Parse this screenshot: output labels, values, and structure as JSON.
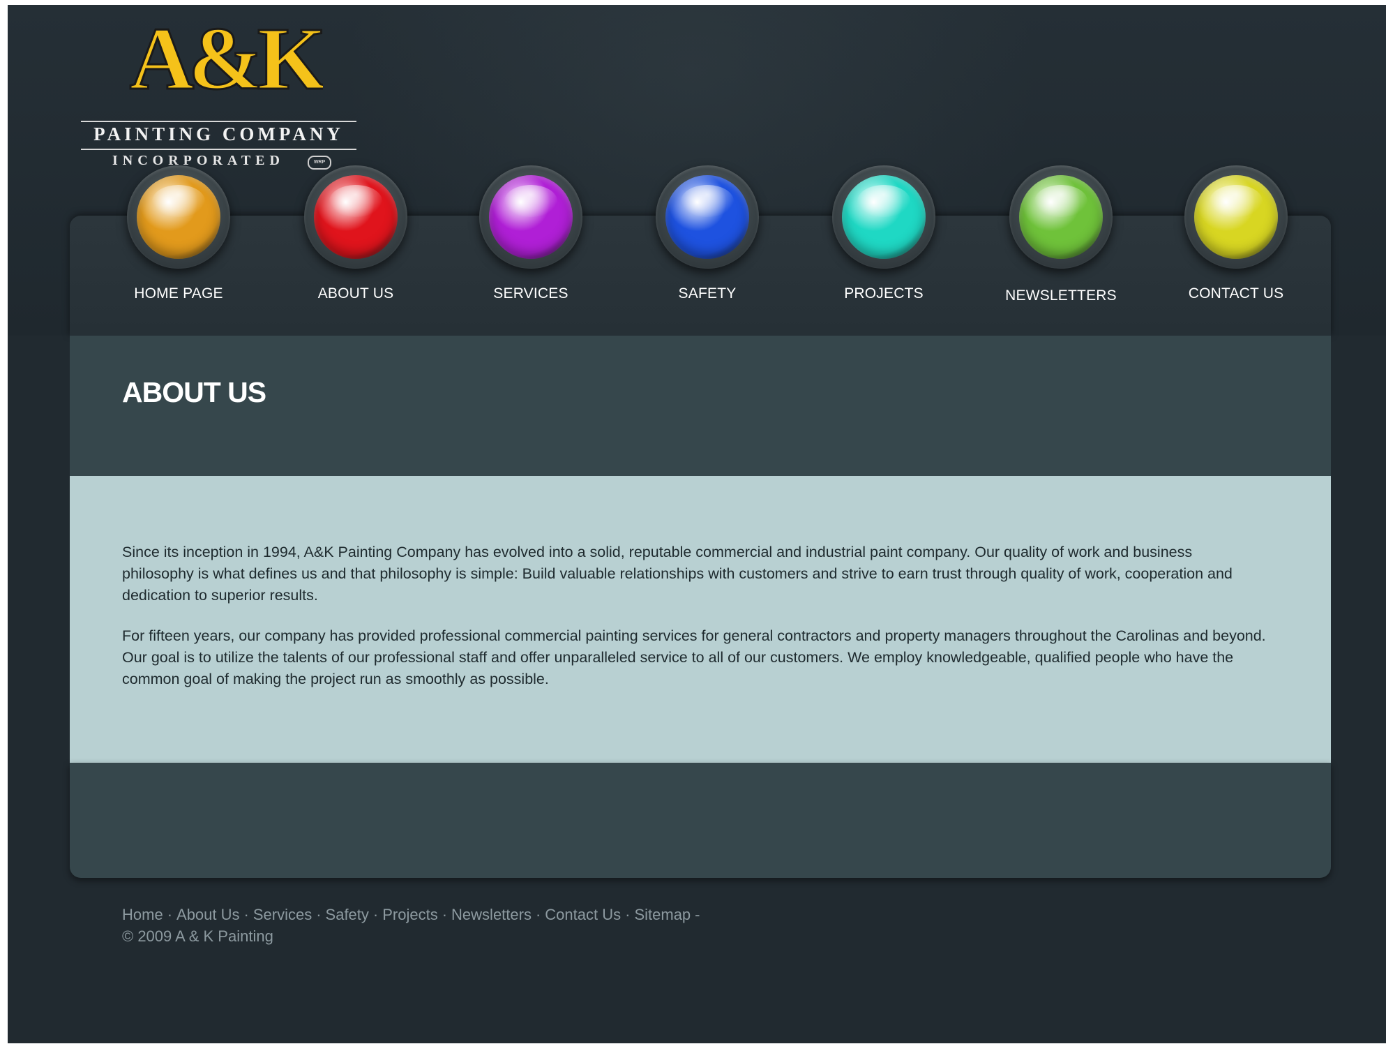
{
  "brand": {
    "logo_mark": "A&K",
    "company": "PAINTING COMPANY",
    "incorporated": "INCORPORATED",
    "badge": "WRP",
    "colors": {
      "logo_yellow": "#f5c21a",
      "logo_outline": "#1a1a1a"
    }
  },
  "nav": {
    "items": [
      {
        "label": "HOME PAGE",
        "orb_color": "#e29a1c",
        "orb_icon": "orange-orb-icon"
      },
      {
        "label": "ABOUT US",
        "orb_color": "#e0141c",
        "orb_icon": "red-orb-icon"
      },
      {
        "label": "SERVICES",
        "orb_color": "#b01fd6",
        "orb_icon": "purple-orb-icon"
      },
      {
        "label": "SAFETY",
        "orb_color": "#1e52e0",
        "orb_icon": "blue-orb-icon"
      },
      {
        "label": "PROJECTS",
        "orb_color": "#1fd8c4",
        "orb_icon": "teal-orb-icon"
      },
      {
        "label": "NEWSLETTERS",
        "orb_color": "#6fc23a",
        "orb_icon": "green-orb-icon"
      },
      {
        "label": "CONTACT US",
        "orb_color": "#d8d622",
        "orb_icon": "yellow-orb-icon"
      }
    ]
  },
  "page": {
    "title": "ABOUT US",
    "paragraphs": [
      "Since its inception in 1994, A&K Painting Company has evolved into a solid, reputable commercial and industrial paint company. Our quality of work and business philosophy is what defines us and that philosophy is simple: Build valuable relationships with customers and strive to earn trust through quality of work, cooperation and dedication to superior results.",
      "For fifteen years, our company has provided professional commercial painting services for general contractors and property managers throughout the Carolinas and beyond. Our goal is to utilize the talents of our professional staff and offer unparalleled service to all of our customers. We employ knowledgeable, qualified people who have the common goal of making the project run as smoothly as possible."
    ]
  },
  "footer": {
    "links": [
      "Home",
      "About Us",
      "Services",
      "Safety",
      "Projects",
      "Newsletters",
      "Contact Us",
      "Sitemap"
    ],
    "separator": "·",
    "trailing": "-",
    "copyright": "© 2009 A & K Painting"
  },
  "colors": {
    "background": "#212a30",
    "panel": "#36474c",
    "content": "#b8d0d2"
  }
}
